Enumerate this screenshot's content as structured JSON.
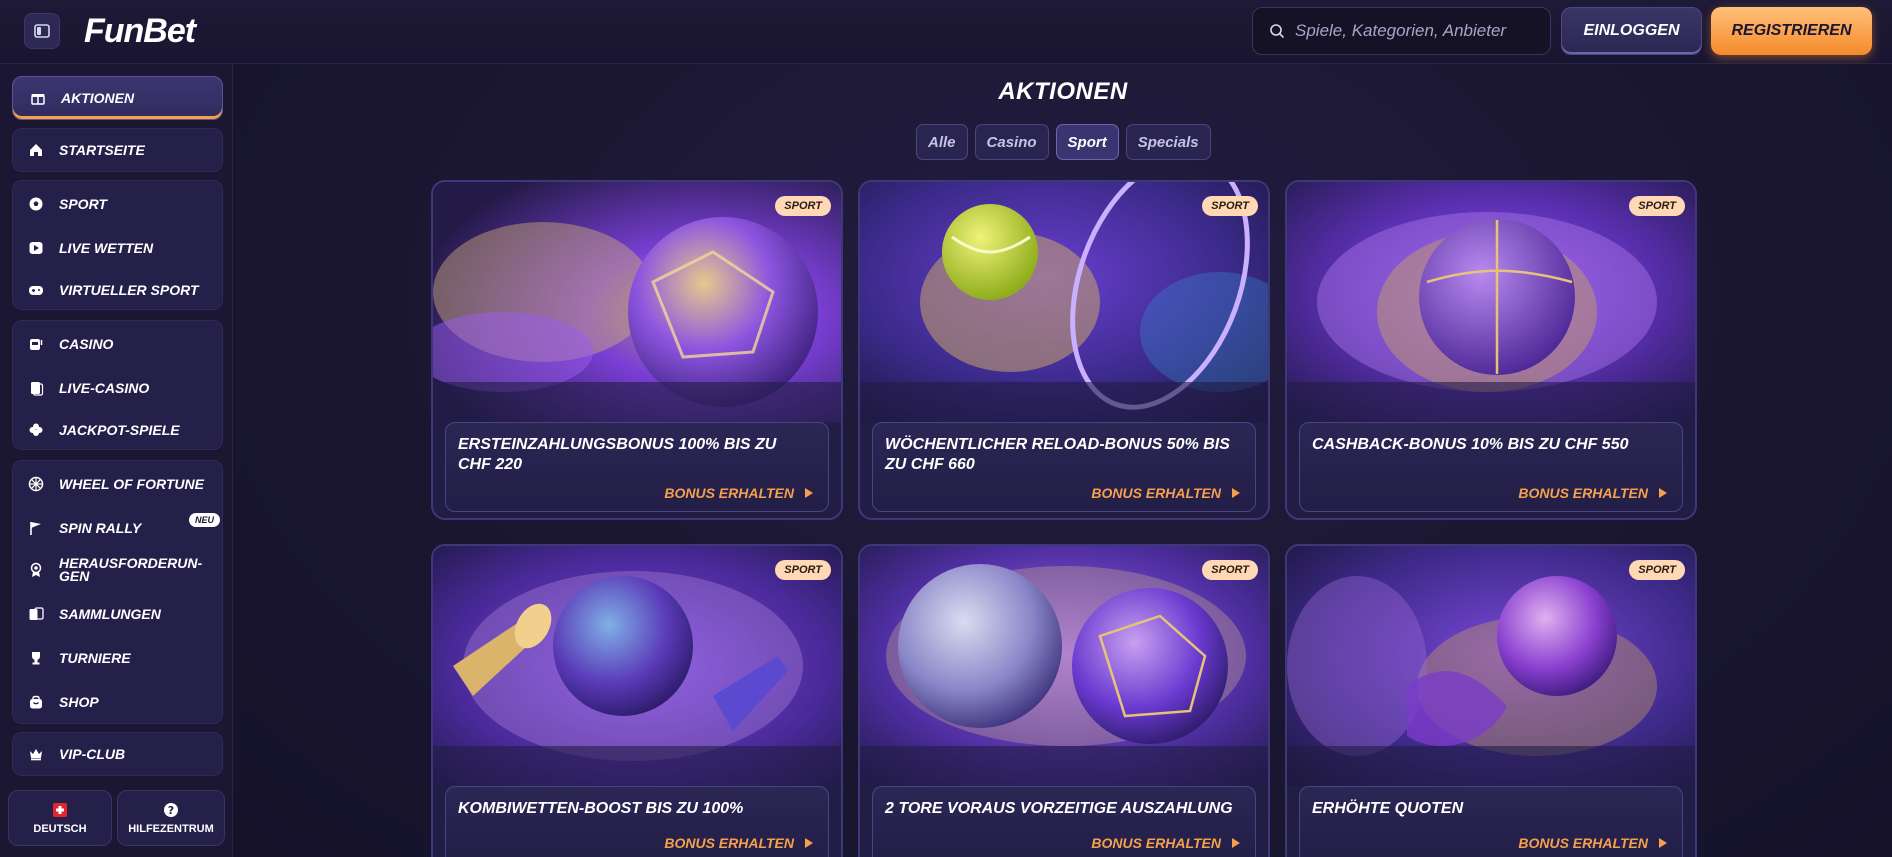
{
  "header": {
    "logo": "FunBet",
    "search_placeholder": "Spiele, Kategorien, Anbieter",
    "login_label": "EINLOGGEN",
    "register_label": "REGISTRIEREN"
  },
  "sidebar": {
    "promo_item": "AKTIONEN",
    "home_item": "STARTSEITE",
    "sport_items": [
      "SPORT",
      "LIVE WETTEN",
      "VIRTUELLER SPORT"
    ],
    "casino_items": [
      "CASINO",
      "LIVE-CASINO",
      "JACKPOT-SPIELE"
    ],
    "extra_items": [
      "WHEEL OF FORTUNE",
      "SPIN RALLY",
      "HERAUSFORDERUN-GEN",
      "SAMMLUNGEN",
      "TURNIERE",
      "SHOP"
    ],
    "neu_badge": "NEU",
    "vip_item": "VIP-CLUB",
    "language_label": "DEUTSCH",
    "help_label": "HILFEZENTRUM"
  },
  "main": {
    "title": "AKTIONEN",
    "filters": [
      "Alle",
      "Casino",
      "Sport",
      "Specials"
    ],
    "active_filter": "Sport",
    "cards": [
      {
        "badge": "SPORT",
        "title": "ERSTEINZAHLUNGSBONUS 100% BIS ZU CHF 220",
        "cta": "BONUS ERHALTEN"
      },
      {
        "badge": "SPORT",
        "title": "WÖCHENTLICHER RELOAD-BONUS 50% BIS ZU CHF 660",
        "cta": "BONUS ERHALTEN"
      },
      {
        "badge": "SPORT",
        "title": "CASHBACK-BONUS 10% BIS ZU CHF 550",
        "cta": "BONUS ERHALTEN"
      },
      {
        "badge": "SPORT",
        "title": "KOMBIWETTEN-BOOST BIS ZU 100%",
        "cta": "BONUS ERHALTEN"
      },
      {
        "badge": "SPORT",
        "title": "2 TORE VORAUS VORZEITIGE AUSZAHLUNG",
        "cta": "BONUS ERHALTEN"
      },
      {
        "badge": "SPORT",
        "title": "ERHÖHTE QUOTEN",
        "cta": "BONUS ERHALTEN"
      }
    ]
  },
  "colors": {
    "accent_orange": "#f58a2a",
    "cta_orange": "#f5a04c",
    "panel": "#24204a",
    "background": "#16132a"
  }
}
